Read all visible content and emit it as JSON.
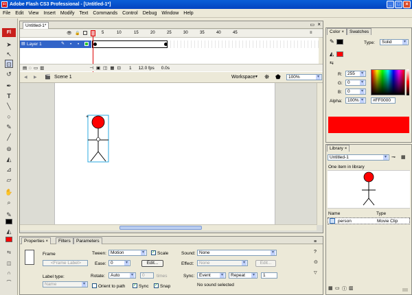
{
  "window": {
    "title": "Adobe Flash CS3 Professional - [Untitled-1*]",
    "app_badge": "Fl"
  },
  "menu": [
    "File",
    "Edit",
    "View",
    "Insert",
    "Modify",
    "Text",
    "Commands",
    "Control",
    "Debug",
    "Window",
    "Help"
  ],
  "document": {
    "tab": "Untitled-1*",
    "ruler": [
      "5",
      "10",
      "15",
      "20",
      "25",
      "30",
      "35",
      "40",
      "45"
    ],
    "layer_name": "Layer 1",
    "frame_current": "1",
    "fps": "12.0 fps",
    "time": "0.0s",
    "scene": "Scene 1",
    "workspace": "Workspace",
    "zoom": "100%"
  },
  "properties": {
    "tabs": [
      "Properties",
      "Filters",
      "Parameters"
    ],
    "frame_label": "Frame",
    "frame_label_placeholder": "<Frame Label>",
    "label_type_label": "Label type:",
    "label_type_value": "Name",
    "tween_label": "Tween:",
    "tween_value": "Motion",
    "scale_label": "Scale",
    "ease_label": "Ease:",
    "ease_value": "0",
    "edit_label": "Edit...",
    "rotate_label": "Rotate:",
    "rotate_value": "Auto",
    "rotate_times_value": "0",
    "times_label": "times",
    "orient_label": "Orient to path",
    "sync_cb_label": "Sync",
    "snap_label": "Snap",
    "sound_label": "Sound:",
    "sound_value": "None",
    "effect_label": "Effect:",
    "effect_value": "None",
    "effect_edit": "Edit...",
    "sync_label": "Sync:",
    "sync_value": "Event",
    "repeat_value": "Repeat",
    "repeat_count": "1",
    "no_sound": "No sound selected"
  },
  "color_panel": {
    "tabs": [
      "Color",
      "Swatches"
    ],
    "type_label": "Type:",
    "type_value": "Solid",
    "r_label": "R:",
    "r_value": "255",
    "g_label": "G:",
    "g_value": "0",
    "b_label": "B:",
    "b_value": "0",
    "alpha_label": "Alpha:",
    "alpha_value": "100%",
    "hex_value": "#FF0000",
    "fill_color": "#ff0000"
  },
  "library_panel": {
    "tab": "Library",
    "document": "Untitled-1",
    "count": "One item in library",
    "col_name": "Name",
    "col_type": "Type",
    "items": [
      {
        "name": "person",
        "type": "Movie Clip"
      }
    ]
  }
}
